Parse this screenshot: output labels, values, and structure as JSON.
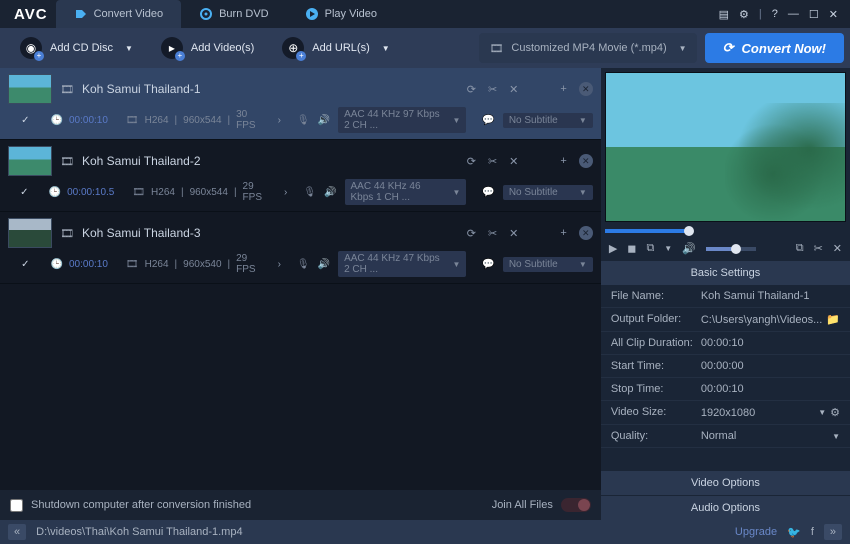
{
  "logo": "AVC",
  "tabs": {
    "convert": "Convert Video",
    "burn": "Burn DVD",
    "play": "Play Video"
  },
  "toolbar": {
    "addcd": "Add CD Disc",
    "addvideos": "Add Video(s)",
    "addurls": "Add URL(s)"
  },
  "profile": "Customized MP4 Movie (*.mp4)",
  "convert_btn": "Convert Now!",
  "files": [
    {
      "title": "Koh Samui Thailand-1",
      "duration": "00:00:10",
      "codec": "H264",
      "res": "960x544",
      "fps": "30 FPS",
      "audio": "AAC 44 KHz 97 Kbps 2 CH ...",
      "subtitle": "No Subtitle"
    },
    {
      "title": "Koh Samui Thailand-2",
      "duration": "00:00:10.5",
      "codec": "H264",
      "res": "960x544",
      "fps": "29 FPS",
      "audio": "AAC 44 KHz 46 Kbps 1 CH ...",
      "subtitle": "No Subtitle"
    },
    {
      "title": "Koh Samui Thailand-3",
      "duration": "00:00:10",
      "codec": "H264",
      "res": "960x540",
      "fps": "29 FPS",
      "audio": "AAC 44 KHz 47 Kbps 2 CH ...",
      "subtitle": "No Subtitle"
    }
  ],
  "left_footer": {
    "shutdown": "Shutdown computer after conversion finished",
    "joinall": "Join All Files"
  },
  "settings": {
    "header": "Basic Settings",
    "rows": {
      "filename": {
        "k": "File Name:",
        "v": "Koh Samui Thailand-1"
      },
      "output": {
        "k": "Output Folder:",
        "v": "C:\\Users\\yangh\\Videos..."
      },
      "clipdur": {
        "k": "All Clip Duration:",
        "v": "00:00:10"
      },
      "start": {
        "k": "Start Time:",
        "v": "00:00:00"
      },
      "stop": {
        "k": "Stop Time:",
        "v": "00:00:10"
      },
      "vsize": {
        "k": "Video Size:",
        "v": "1920x1080"
      },
      "quality": {
        "k": "Quality:",
        "v": "Normal"
      }
    }
  },
  "options": {
    "video": "Video Options",
    "audio": "Audio Options"
  },
  "statusbar": {
    "path": "D:\\videos\\Thai\\Koh Samui Thailand-1.mp4",
    "upgrade": "Upgrade"
  }
}
